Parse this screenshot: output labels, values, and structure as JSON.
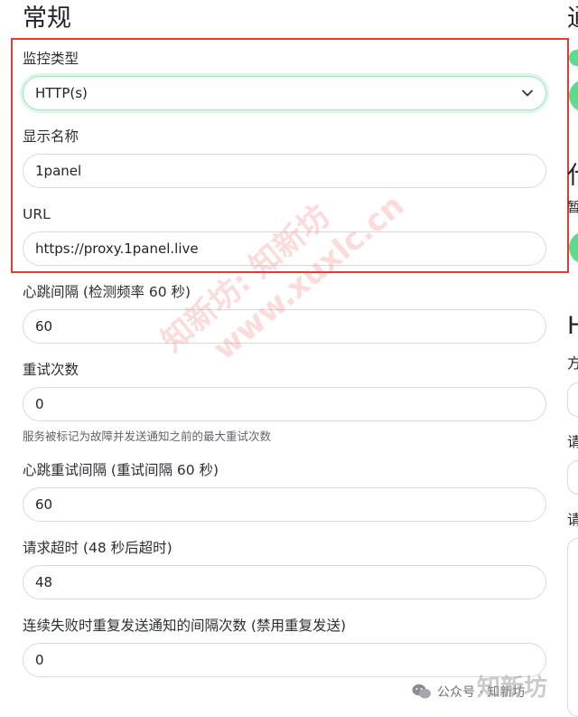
{
  "general": {
    "title": "常规",
    "monitor_type": {
      "label": "监控类型",
      "value": "HTTP(s)"
    },
    "display_name": {
      "label": "显示名称",
      "value": "1panel"
    },
    "url": {
      "label": "URL",
      "value": "https://proxy.1panel.live"
    },
    "heartbeat_interval": {
      "label": "心跳间隔 (检测频率 60 秒)",
      "value": "60"
    },
    "retries": {
      "label": "重试次数",
      "value": "0",
      "help": "服务被标记为故障并发送通知之前的最大重试次数"
    },
    "retry_interval": {
      "label": "心跳重试间隔 (重试间隔 60 秒)",
      "value": "60"
    },
    "request_timeout": {
      "label": "请求超时 (48 秒后超时)",
      "value": "48"
    },
    "resend_interval": {
      "label": "连续失败时重复发送通知的间隔次数 (禁用重复发送)",
      "value": "0"
    }
  },
  "right_panel": {
    "heading_1": "通",
    "heading_2": "代",
    "subtext": "暂",
    "heading_3": "H",
    "label_1": "方",
    "label_2": "请",
    "label_3": "请"
  },
  "watermark": {
    "line1": "知新坊: 知新坊",
    "line2": "www.xuxlc.cn"
  },
  "footer": {
    "badge": "公众号 · 知新坊",
    "brand": "知新坊"
  },
  "colors": {
    "accent_green": "#5cdd8b",
    "highlight_red": "#e53935",
    "watermark_red": "#f05c5c"
  }
}
